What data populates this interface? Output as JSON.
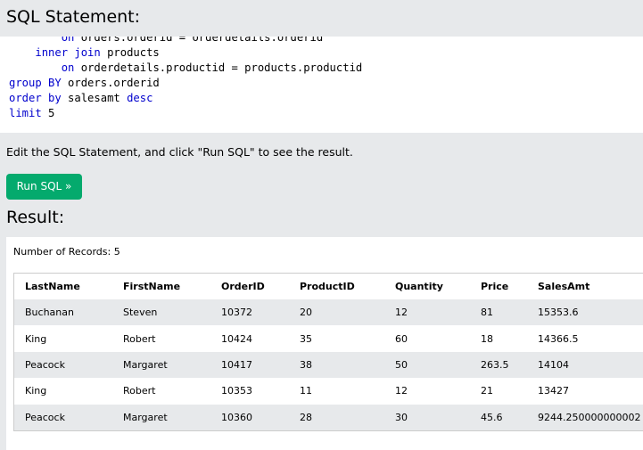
{
  "sql_section": {
    "title": "SQL Statement:",
    "code_lines": [
      [
        {
          "t": "        "
        },
        {
          "t": "on",
          "kw": true
        },
        {
          "t": " orders.orderid = orderdetails.orderid"
        }
      ],
      [
        {
          "t": "    "
        },
        {
          "t": "inner join",
          "kw": true
        },
        {
          "t": " products"
        }
      ],
      [
        {
          "t": "        "
        },
        {
          "t": "on",
          "kw": true
        },
        {
          "t": " orderdetails.productid = products.productid"
        }
      ],
      [
        {
          "t": "group BY",
          "kw": true
        },
        {
          "t": " orders.orderid"
        }
      ],
      [
        {
          "t": "order by",
          "kw": true
        },
        {
          "t": " salesamt "
        },
        {
          "t": "desc",
          "kw": true
        }
      ],
      [
        {
          "t": "limit",
          "kw": true
        },
        {
          "t": " 5"
        }
      ]
    ],
    "keyword_color": "#0000cd"
  },
  "instructions": "Edit the SQL Statement, and click \"Run SQL\" to see the result.",
  "run_button": {
    "label": "Run SQL »",
    "color": "#04aa6d"
  },
  "result_section": {
    "title": "Result:",
    "record_count": "Number of Records: 5",
    "columns": [
      "LastName",
      "FirstName",
      "OrderID",
      "ProductID",
      "Quantity",
      "Price",
      "SalesAmt"
    ],
    "rows": [
      [
        "Buchanan",
        "Steven",
        "10372",
        "20",
        "12",
        "81",
        "15353.6"
      ],
      [
        "King",
        "Robert",
        "10424",
        "35",
        "60",
        "18",
        "14366.5"
      ],
      [
        "Peacock",
        "Margaret",
        "10417",
        "38",
        "50",
        "263.5",
        "14104"
      ],
      [
        "King",
        "Robert",
        "10353",
        "11",
        "12",
        "21",
        "13427"
      ],
      [
        "Peacock",
        "Margaret",
        "10360",
        "28",
        "30",
        "45.6",
        "9244.250000000002"
      ]
    ]
  }
}
